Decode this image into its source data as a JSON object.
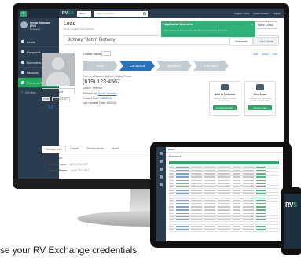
{
  "app": {
    "logo_main": "RV",
    "logo_accent": "GS",
    "org_select": "Select",
    "search_placeholder": "Search RVSEOS...",
    "top_links": [
      "Support Ticket",
      "Quick Connect",
      "Log out"
    ]
  },
  "user": {
    "name": "Gregg Holcuppe (RVX",
    "role": "Licensee)"
  },
  "sidebar": {
    "items": [
      {
        "label": "Leads",
        "icon": "users-icon",
        "active": false
      },
      {
        "label": "Prospects",
        "icon": "person-icon",
        "active": false
      },
      {
        "label": "Borrowers",
        "icon": "briefcase-icon",
        "active": false
      },
      {
        "label": "Network",
        "icon": "network-icon",
        "active": false
      },
      {
        "label": "Premium Tools",
        "icon": "tools-icon",
        "active": true
      }
    ],
    "help": "Get Help"
  },
  "page": {
    "title": "Lead",
    "breadcrumb": "Home / Leads / John Doheny",
    "new_lead": "New Lead"
  },
  "toast": {
    "title": "Application Submitted",
    "text": "The request for the loan was submitted successfully to the lender"
  },
  "lead": {
    "name": "Johnny \"John\" Doheny",
    "tabs": [
      "Overview",
      "Loan Detail"
    ],
    "favorite": "Favorite",
    "dob_label": "DOB",
    "dob_value": "12/12/1967",
    "age_label": "Age",
    "age_value": "83",
    "status_label": "Contact Status",
    "actions": [
      "Edit",
      "Delete",
      "Print"
    ],
    "pipeline": [
      "New",
      "Contacted",
      "Qualified",
      "Interested"
    ],
    "preferred_label": "Preferred Contact Method:",
    "preferred_value": "Mobile Phone",
    "phone": "(619) 123-4567",
    "source_label": "Source:",
    "source_value": "Referral",
    "referred_label": "Referred By:",
    "referred_value": "Aaron Johnston",
    "created_label": "Created Date:",
    "created_value": "12/1/2015",
    "updated_label": "Last Updated Date:",
    "updated_value": "4/8/2016"
  },
  "cards": [
    {
      "title": "Add to Network",
      "text": "Move prospect out of the lead process",
      "button": "Convert Contact"
    },
    {
      "title": "New Loan",
      "text": "Create a new loan based on this contact's info",
      "button": "Create Loan"
    }
  ],
  "subtabs": [
    "Contact Info",
    "Details",
    "Relationships",
    "Notes"
  ],
  "communication": {
    "title": "Communication",
    "home_label": "Home Phone:",
    "home_value": "(619) 123-4567",
    "mobile_label": "Mobile Phone:",
    "mobile_value": "(619) 123-4567"
  },
  "tablet": {
    "logo": "RVGS",
    "title": "Borrowers"
  },
  "phone": {
    "logo_main": "RV",
    "logo_accent": "S"
  },
  "caption": "se your RV Exchange credentials."
}
